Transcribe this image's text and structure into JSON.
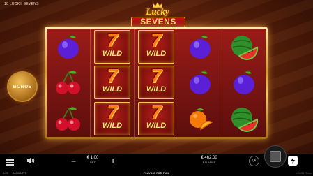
{
  "header": {
    "game_title": "10 LUCKY SEVENS"
  },
  "logo": {
    "line1": "Lucky",
    "line2": "SEVENS"
  },
  "bonus": {
    "label": "BONUS"
  },
  "reels": [
    [
      "plum",
      "plum",
      "cherry",
      "cherry",
      "cherry"
    ],
    [
      "wild",
      "wild",
      "wild"
    ],
    [
      "wild",
      "wild",
      "wild"
    ],
    [
      "plum",
      "plum",
      "orange"
    ],
    [
      "watermelon",
      "plum",
      "watermelon"
    ]
  ],
  "wild": {
    "seven": "7",
    "label": "WILD"
  },
  "footer": {
    "bet_value": "€ 1.00",
    "bet_label": "BET",
    "balance_value": "€ 462.00",
    "balance_label": "BALANCE",
    "minus": "−",
    "plus": "+",
    "autoplay": "⟳"
  },
  "status": {
    "time": "9:23",
    "session_id": "0000IA.P/T",
    "play_for_fun": "PLAYING FOR FUN!",
    "brand": "0.0001 Relax"
  },
  "colors": {
    "frame": "#d39a2b",
    "reel_bg": "#9b1c18",
    "accent": "#ffd23f"
  }
}
